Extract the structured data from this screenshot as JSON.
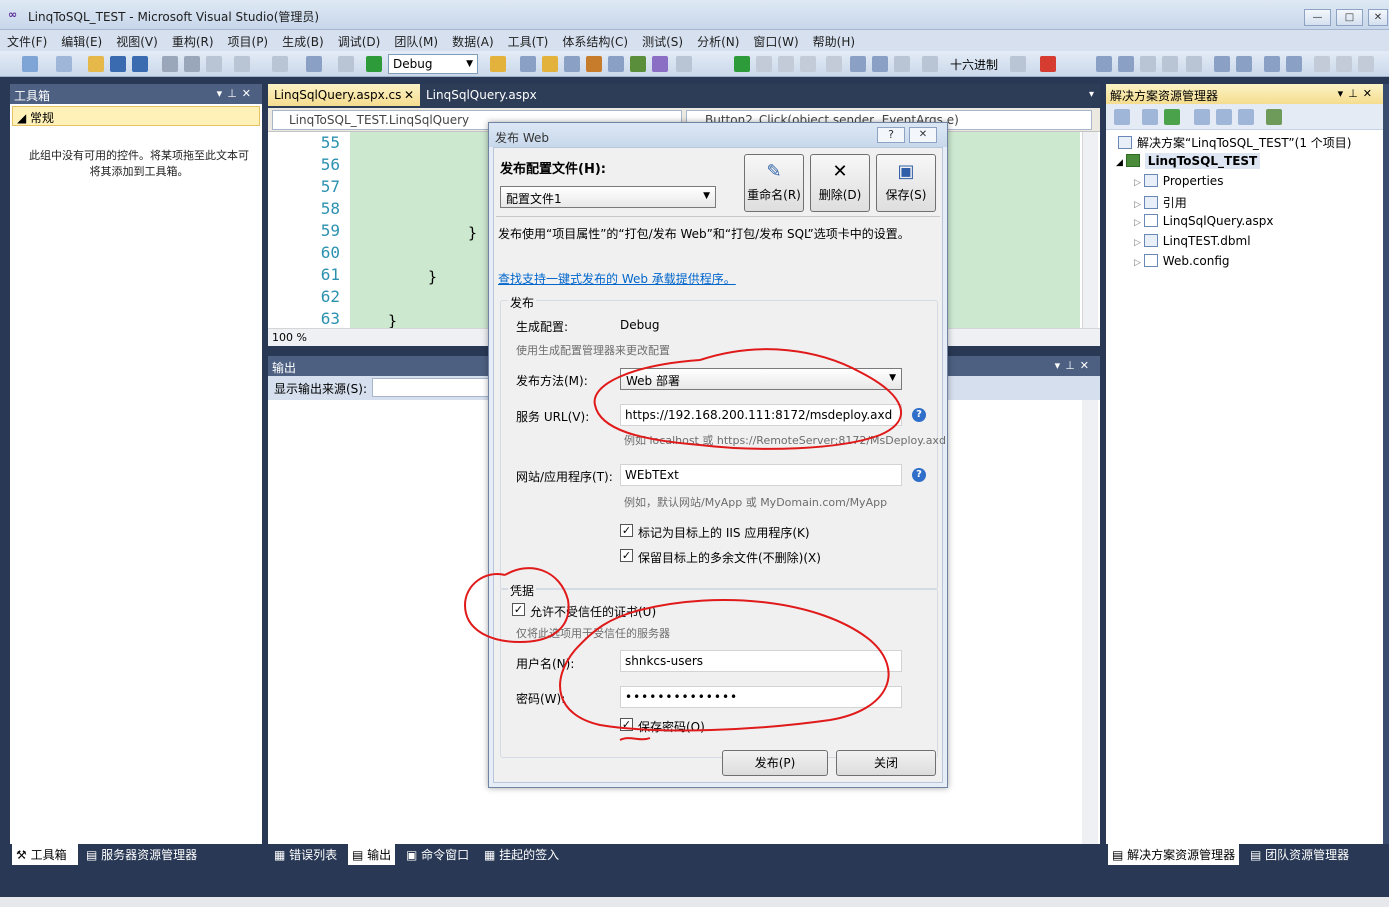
{
  "window": {
    "title": "LinqToSQL_TEST - Microsoft Visual Studio(管理员)",
    "min": "—",
    "max": "□",
    "close": "✕"
  },
  "menu": [
    "文件(F)",
    "编辑(E)",
    "视图(V)",
    "重构(R)",
    "项目(P)",
    "生成(B)",
    "调试(D)",
    "团队(M)",
    "数据(A)",
    "工具(T)",
    "体系结构(C)",
    "测试(S)",
    "分析(N)",
    "窗口(W)",
    "帮助(H)"
  ],
  "toolbar": {
    "config": "Debug",
    "hex": "十六进制"
  },
  "toolbox": {
    "title": "工具箱",
    "group": "常规",
    "message": "此组中没有可用的控件。将某项拖至此文本可将其添加到工具箱。"
  },
  "editor": {
    "tabs": [
      "LinqSqlQuery.aspx.cs",
      "LinqSqlQuery.aspx"
    ],
    "class_dropdown": "LinqToSQL_TEST.LinqSqlQuery",
    "member_dropdown": "Button2_Click(object sender, EventArgs e)",
    "line_numbers": [
      "55",
      "56",
      "57",
      "58",
      "59",
      "60",
      "61",
      "62",
      "63"
    ],
    "zoom": "100 %"
  },
  "output": {
    "title": "输出",
    "source_label": "显示输出来源(S):"
  },
  "solution": {
    "title": "解决方案资源管理器",
    "root": "解决方案“LinqToSQL_TEST”(1 个项目)",
    "project": "LinqToSQL_TEST",
    "items": [
      "Properties",
      "引用",
      "LinqSqlQuery.aspx",
      "LinqTEST.dbml",
      "Web.config"
    ]
  },
  "bottom_tabs_left": [
    "工具箱",
    "服务器资源管理器"
  ],
  "bottom_tabs_mid": [
    "错误列表",
    "输出",
    "命令窗口",
    "挂起的签入"
  ],
  "bottom_tabs_right": [
    "解决方案资源管理器",
    "团队资源管理器"
  ],
  "dialog": {
    "title": "发布 Web",
    "profile_label": "发布配置文件(H):",
    "profile_value": "配置文件1",
    "rename": "重命名(R)",
    "delete": "删除(D)",
    "save": "保存(S)",
    "info": "发布使用“项目属性”的“打包/发布 Web”和“打包/发布 SQL”选项卡中的设置。",
    "link": "查找支持一键式发布的 Web 承载提供程序。",
    "publish_group": "发布",
    "build_config_label": "生成配置:",
    "build_config_value": "Debug",
    "build_config_hint": "使用生成配置管理器来更改配置",
    "method_label": "发布方法(M):",
    "method_value": "Web 部署",
    "url_label": "服务 URL(V):",
    "url_value": "https://192.168.200.111:8172/msdeploy.axd",
    "url_hint": "例如 localhost 或 https://RemoteServer:8172/MsDeploy.axd",
    "site_label": "网站/应用程序(T):",
    "site_value": "WEbTExt",
    "site_hint": "例如，默认网站/MyApp 或 MyDomain.com/MyApp",
    "iis_check": "标记为目标上的 IIS 应用程序(K)",
    "keep_check": "保留目标上的多余文件(不删除)(X)",
    "cred_group": "凭据",
    "untrusted_check": "允许不受信任的证书(U)",
    "untrusted_hint": "仅将此选项用于受信任的服务器",
    "user_label": "用户名(N):",
    "user_value": "shnkcs-users",
    "pwd_label": "密码(W):",
    "pwd_value": "••••••••••••••",
    "save_pwd": "保存密码(O)",
    "publish_btn": "发布(P)",
    "close_btn": "关闭",
    "help": "?",
    "x": "✕"
  }
}
